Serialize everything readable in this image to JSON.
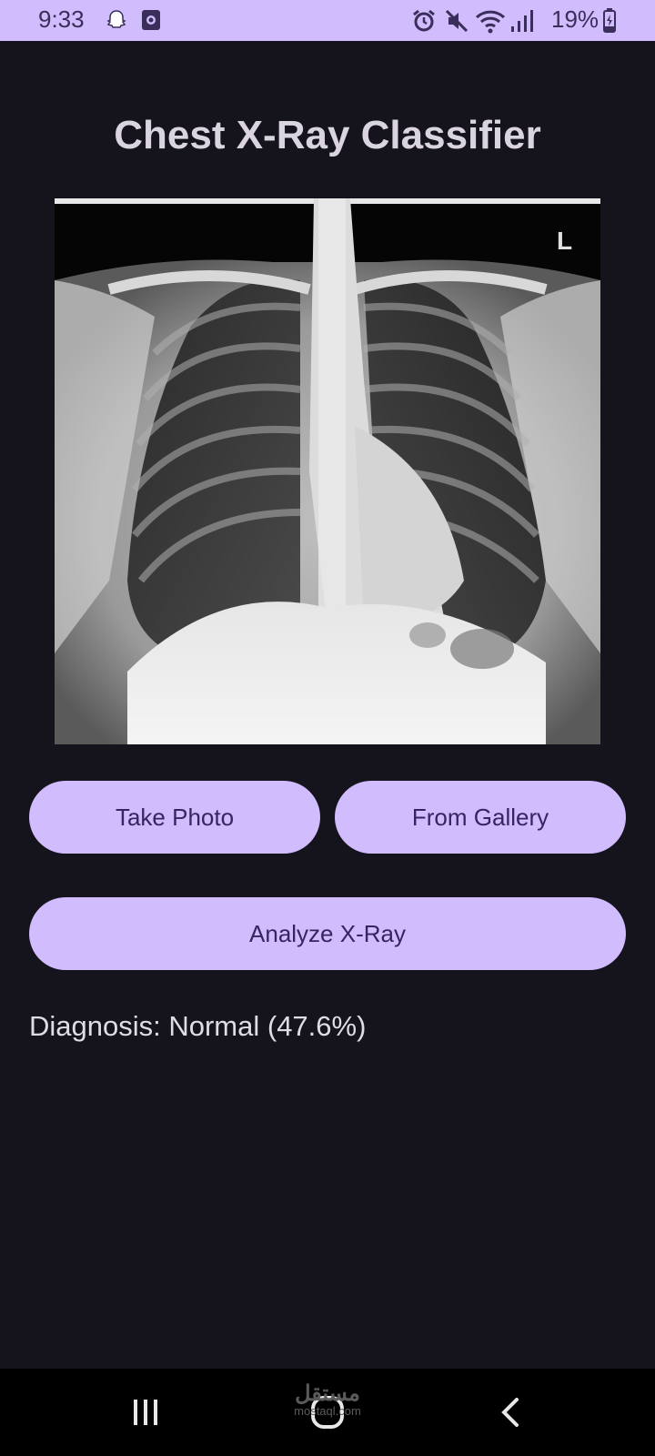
{
  "status_bar": {
    "time": "9:33",
    "battery": "19%",
    "icons": [
      "snapchat-icon",
      "screen-record-icon",
      "alarm-icon",
      "mute-icon",
      "wifi-icon",
      "signal-icon",
      "battery-charging-icon"
    ]
  },
  "app": {
    "title": "Chest X-Ray Classifier",
    "image": {
      "subject": "chest x-ray",
      "marker": "L"
    }
  },
  "buttons": {
    "take_photo": "Take Photo",
    "from_gallery": "From Gallery",
    "analyze": "Analyze X-Ray"
  },
  "result": {
    "text": "Diagnosis: Normal (47.6%)"
  },
  "nav_bar": {
    "buttons": [
      "recents-icon",
      "home-icon",
      "back-icon"
    ]
  },
  "watermark": {
    "line1": "مستقل",
    "line2": "mostaql.com"
  },
  "colors": {
    "background": "#15131b",
    "accent": "#d1bcfd",
    "button_text": "#38245f"
  }
}
